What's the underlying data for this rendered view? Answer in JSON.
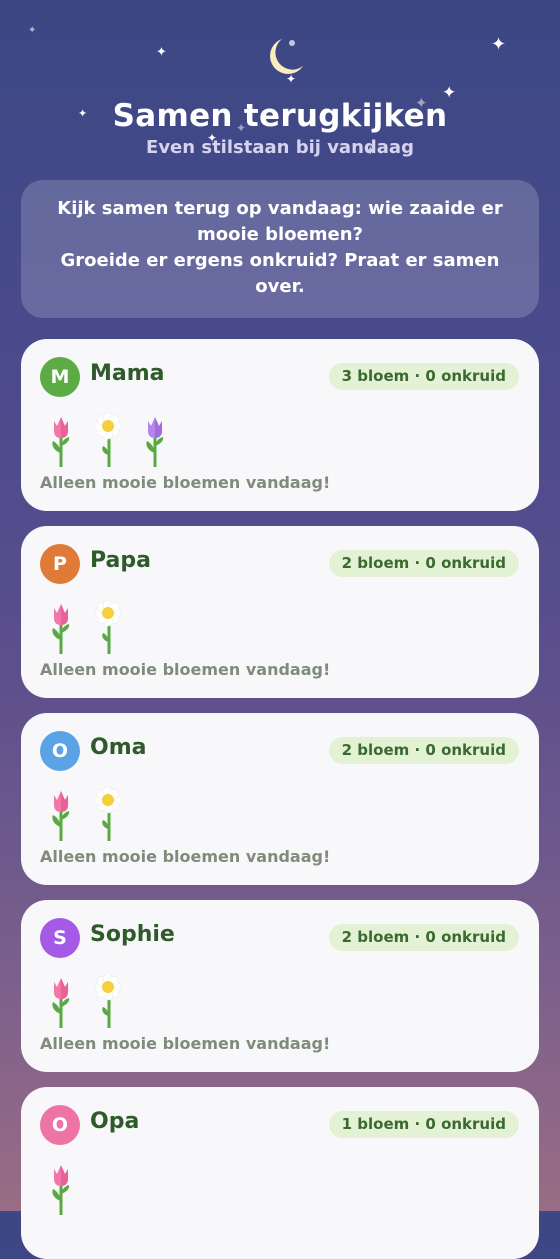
{
  "header": {
    "title": "Samen terugkijken",
    "subtitle": "Even stilstaan bij vandaag"
  },
  "prompt": {
    "line1": "Kijk samen terug op vandaag: wie zaaide er mooie bloemen?",
    "line2": "Groeide er ergens onkruid? Praat er samen over."
  },
  "colors": {
    "background_top": "#3c4784",
    "background_bottom": "#9a6c85",
    "card": "#f8f8fa",
    "name_text": "#2f5a2a",
    "badge_bg": "#e3f1d4"
  },
  "members": [
    {
      "initial": "M",
      "name": "Mama",
      "avatar_color": "#5cab44",
      "badge": "3 bloem · 0 onkruid",
      "flowers": [
        "pink-tulip",
        "daisy",
        "purple-tulip"
      ],
      "caption": "Alleen mooie bloemen vandaag!"
    },
    {
      "initial": "P",
      "name": "Papa",
      "avatar_color": "#e07a38",
      "badge": "2 bloem · 0 onkruid",
      "flowers": [
        "pink-tulip",
        "daisy"
      ],
      "caption": "Alleen mooie bloemen vandaag!"
    },
    {
      "initial": "O",
      "name": "Oma",
      "avatar_color": "#5ca3e6",
      "badge": "2 bloem · 0 onkruid",
      "flowers": [
        "pink-tulip",
        "daisy"
      ],
      "caption": "Alleen mooie bloemen vandaag!"
    },
    {
      "initial": "S",
      "name": "Sophie",
      "avatar_color": "#a45ae6",
      "badge": "2 bloem · 0 onkruid",
      "flowers": [
        "pink-tulip",
        "daisy"
      ],
      "caption": "Alleen mooie bloemen vandaag!"
    },
    {
      "initial": "O",
      "name": "Opa",
      "avatar_color": "#ee74a6",
      "badge": "1 bloem · 0 onkruid",
      "flowers": [
        "pink-tulip"
      ],
      "caption": ""
    }
  ]
}
